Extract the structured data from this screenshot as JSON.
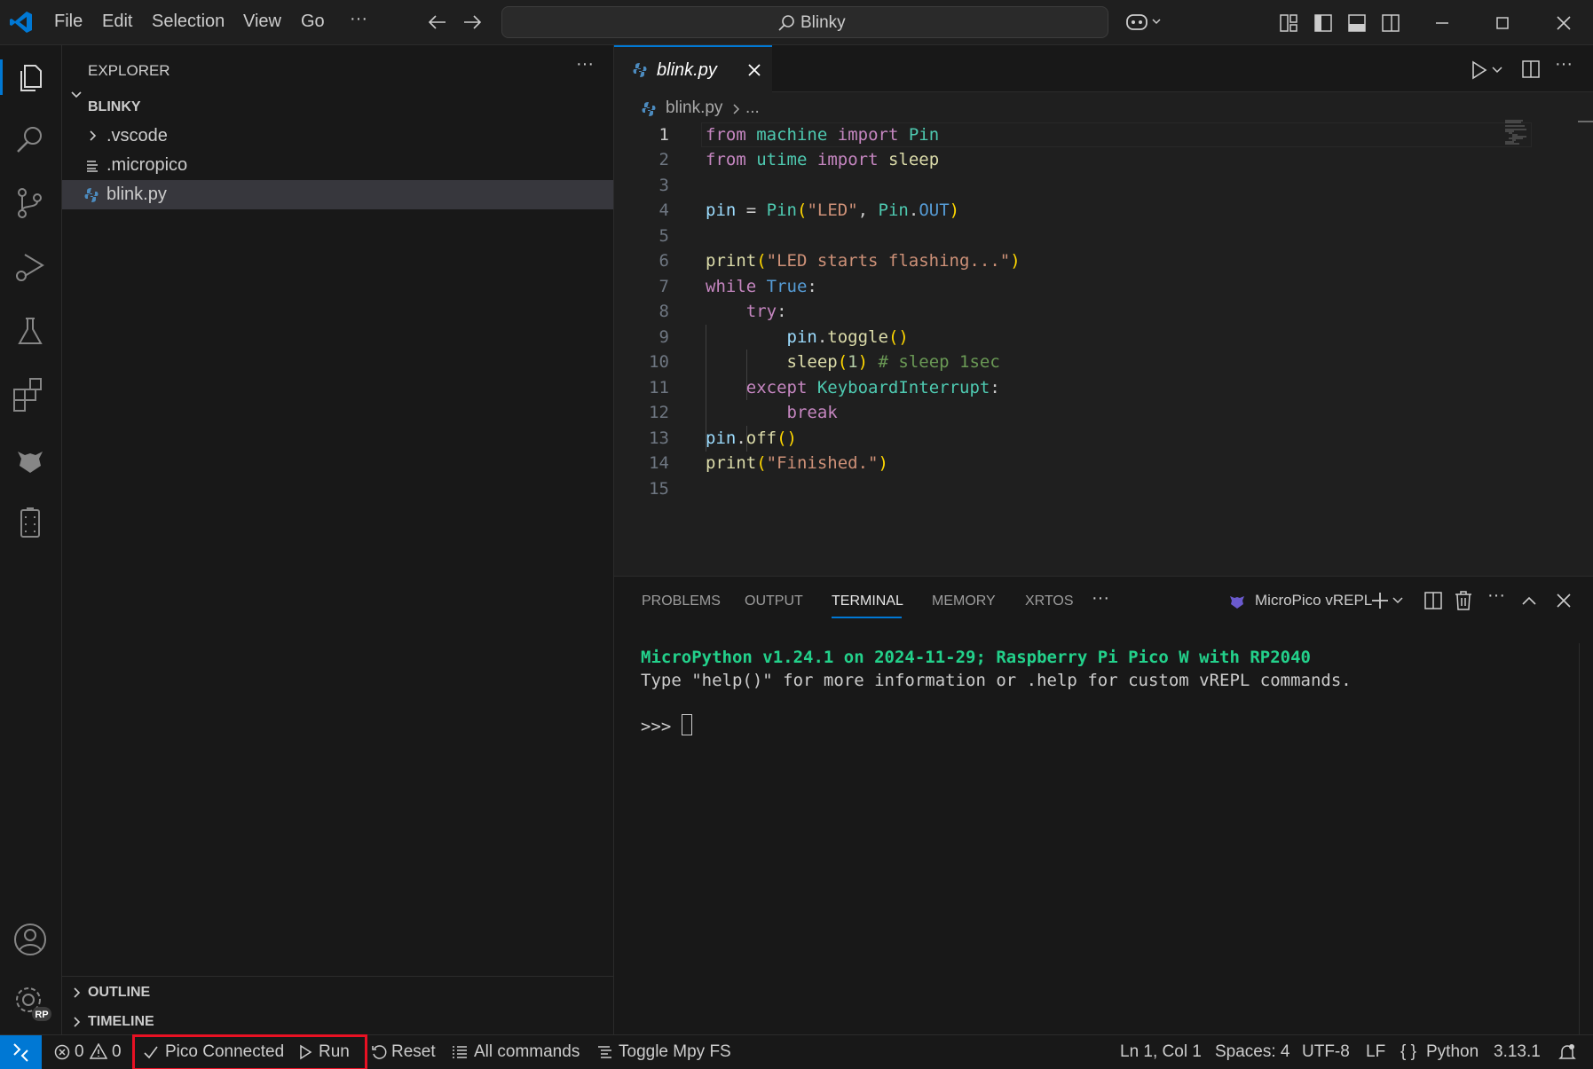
{
  "titlebar": {
    "menus": [
      "File",
      "Edit",
      "Selection",
      "View",
      "Go",
      "···"
    ],
    "search": "Blinky"
  },
  "sidebar": {
    "title": "EXPLORER",
    "folder": "BLINKY",
    "items": [
      ".vscode",
      ".micropico",
      "blink.py"
    ],
    "outline": "OUTLINE",
    "timeline": "TIMELINE"
  },
  "editor": {
    "tab": "blink.py",
    "breadcrumb": "blink.py",
    "breadcrumb_more": "...",
    "line_numbers": [
      "1",
      "2",
      "3",
      "4",
      "5",
      "6",
      "7",
      "8",
      "9",
      "10",
      "11",
      "12",
      "13",
      "14",
      "15"
    ]
  },
  "panel": {
    "tabs": [
      "PROBLEMS",
      "OUTPUT",
      "TERMINAL",
      "MEMORY",
      "XRTOS",
      "···"
    ],
    "terminal_name": "MicroPico vREPL",
    "line1": "MicroPython v1.24.1 on 2024-11-29; Raspberry Pi Pico W with RP2040",
    "line2": "Type \"help()\" for more information or .help for custom vREPL commands.",
    "prompt": ">>>"
  },
  "statusbar": {
    "errors": "0",
    "warnings": "0",
    "pico": "Pico Connected",
    "run": "Run",
    "reset": "Reset",
    "all_commands": "All commands",
    "toggle_fs": "Toggle Mpy FS",
    "position": "Ln 1, Col 1",
    "spaces": "Spaces: 4",
    "encoding": "UTF-8",
    "eol": "LF",
    "language": "Python",
    "version": "3.13.1"
  },
  "accent_color": "#0078d4",
  "highlight_color": "#e81123"
}
